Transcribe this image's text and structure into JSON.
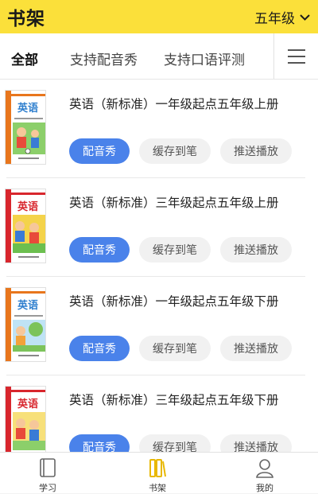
{
  "header": {
    "title": "书架",
    "grade": "五年级",
    "accent_color": "#fbe03a"
  },
  "tabs": [
    {
      "label": "全部",
      "active": true
    },
    {
      "label": "支持配音秀",
      "active": false
    },
    {
      "label": "支持口语评测",
      "active": false
    }
  ],
  "menu_icon": "hamburger-menu-icon",
  "books": [
    {
      "title": "英语（新标准）一年级起点五年级上册",
      "cover_text": "英语",
      "cover_color": "#e8761d",
      "buttons": {
        "dub": "配音秀",
        "cache": "缓存到笔",
        "push": "推送播放"
      }
    },
    {
      "title": "英语（新标准）三年级起点五年级上册",
      "cover_text": "英语",
      "cover_color": "#d8262d",
      "buttons": {
        "dub": "配音秀",
        "cache": "缓存到笔",
        "push": "推送播放"
      }
    },
    {
      "title": "英语（新标准）一年级起点五年级下册",
      "cover_text": "英语",
      "cover_color": "#e8761d",
      "buttons": {
        "dub": "配音秀",
        "cache": "缓存到笔",
        "push": "推送播放"
      }
    },
    {
      "title": "英语（新标准）三年级起点五年级下册",
      "cover_text": "英语",
      "cover_color": "#d8262d",
      "buttons": {
        "dub": "配音秀",
        "cache": "缓存到笔",
        "push": "推送播放"
      }
    }
  ],
  "bottom_nav": [
    {
      "label": "学习",
      "icon": "book-icon",
      "active": false
    },
    {
      "label": "书架",
      "icon": "bookshelf-icon",
      "active": true
    },
    {
      "label": "我的",
      "icon": "user-icon",
      "active": false
    }
  ],
  "colors": {
    "primary_button": "#4a82ea",
    "active_nav": "#e8b800"
  }
}
